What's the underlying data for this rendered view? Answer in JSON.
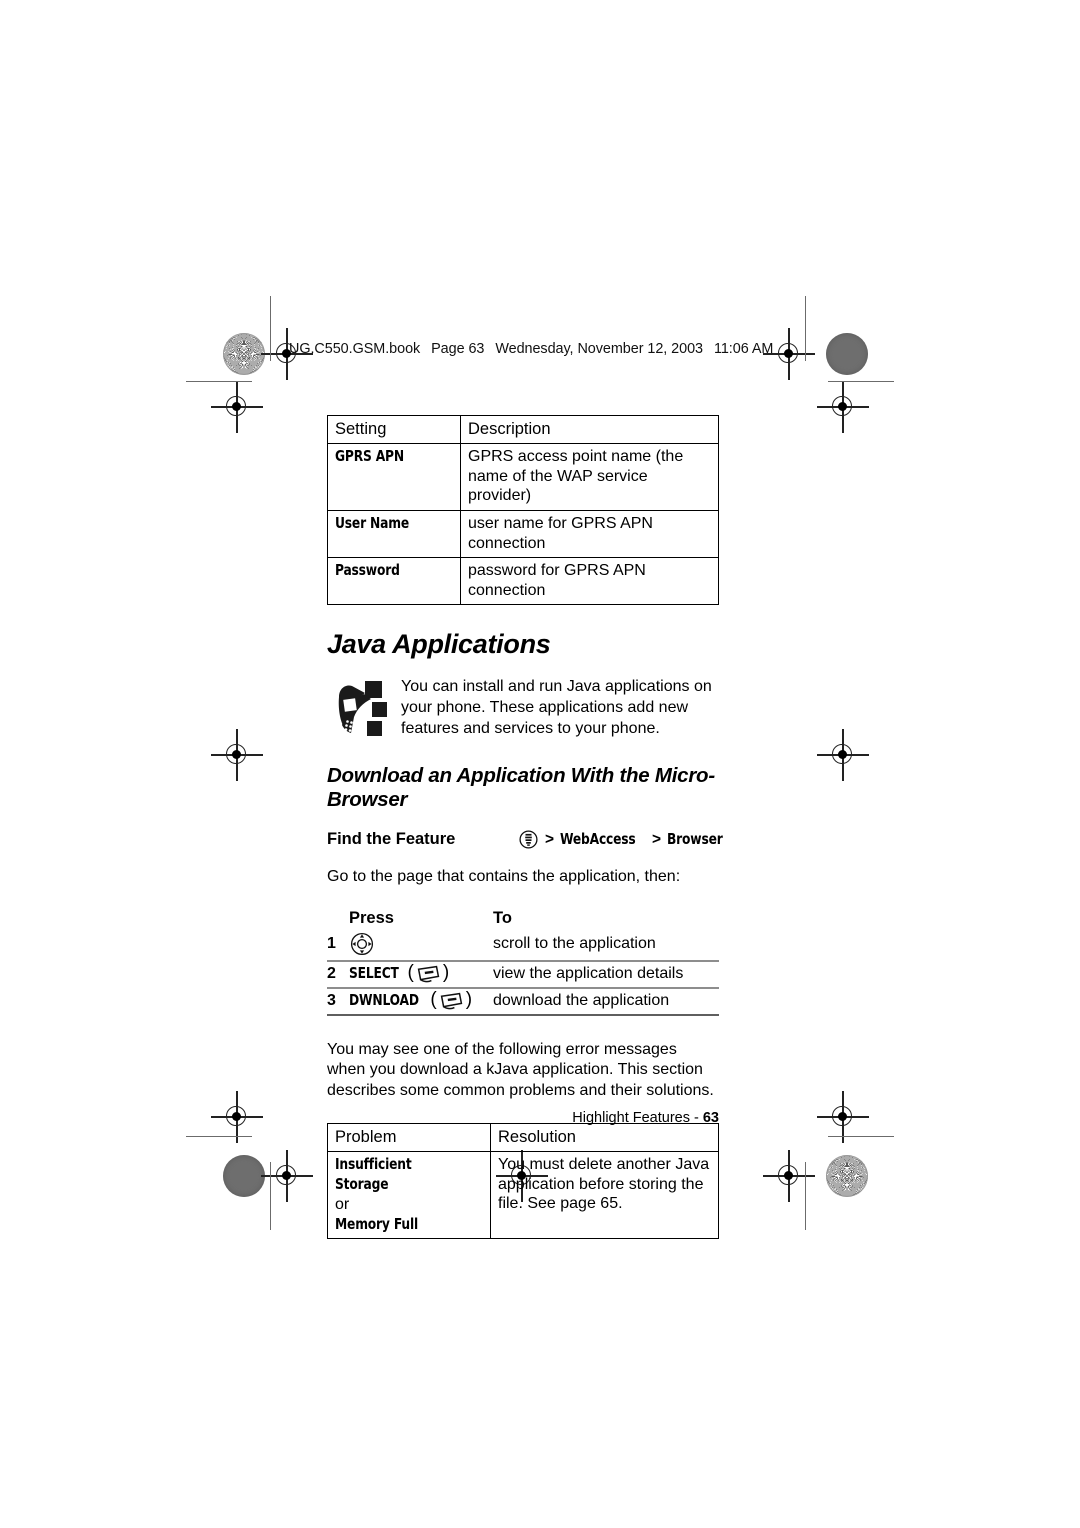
{
  "header": {
    "file_name": "UG.C550.GSM.book",
    "page_label": "Page 63",
    "day": "Wednesday, November 12, 2003",
    "time": "11:06 AM"
  },
  "settings_table": {
    "columns": [
      "Setting",
      "Description"
    ],
    "rows": [
      {
        "setting": "GPRS APN",
        "description": "GPRS access point name (the name of the WAP service provider)"
      },
      {
        "setting": "User Name",
        "description": "user name for GPRS APN connection"
      },
      {
        "setting": "Password",
        "description": "password for GPRS APN connection"
      }
    ]
  },
  "section": {
    "title": "Java Applications",
    "intro": "You can install and run Java applications on your phone. These applications add new features and services to your phone.",
    "intro_icon": "java-phone-icon"
  },
  "subsection": {
    "title": "Download an Application With the Micro-Browser",
    "find_the_feature": {
      "label": "Find the Feature",
      "menu_icon": "menu-key-icon",
      "separator": ">",
      "path": [
        "WebAccess",
        "Browser"
      ]
    },
    "lead_in": "Go to the page that contains the application, then:",
    "steps_table": {
      "columns": [
        "Press",
        "To"
      ],
      "rows": [
        {
          "num": "1",
          "key_label": "",
          "key_icon": "navigation-key-icon",
          "to": "scroll to the application"
        },
        {
          "num": "2",
          "key_label": "SELECT",
          "key_icon": "soft-key-icon",
          "to": "view the application details"
        },
        {
          "num": "3",
          "key_label": "DWNLOAD",
          "key_icon": "soft-key-icon",
          "to": "download the application"
        }
      ]
    },
    "error_intro": "You may see one of the following error messages when you download a kJava application. This section describes some common problems and their solutions.",
    "problem_table": {
      "columns": [
        "Problem",
        "Resolution"
      ],
      "rows": [
        {
          "problem_line1": "Insufficient Storage",
          "problem_line2": "or",
          "problem_line3": "Memory Full",
          "resolution": "You must delete another Java application before storing the file. See page 65."
        }
      ]
    }
  },
  "footer": {
    "label": "Highlight Features -",
    "page_number": "63"
  },
  "colors": {
    "ink": "#000000",
    "rule_gray": "#8d8d8d",
    "registration_gray": "#6e6e6e"
  }
}
